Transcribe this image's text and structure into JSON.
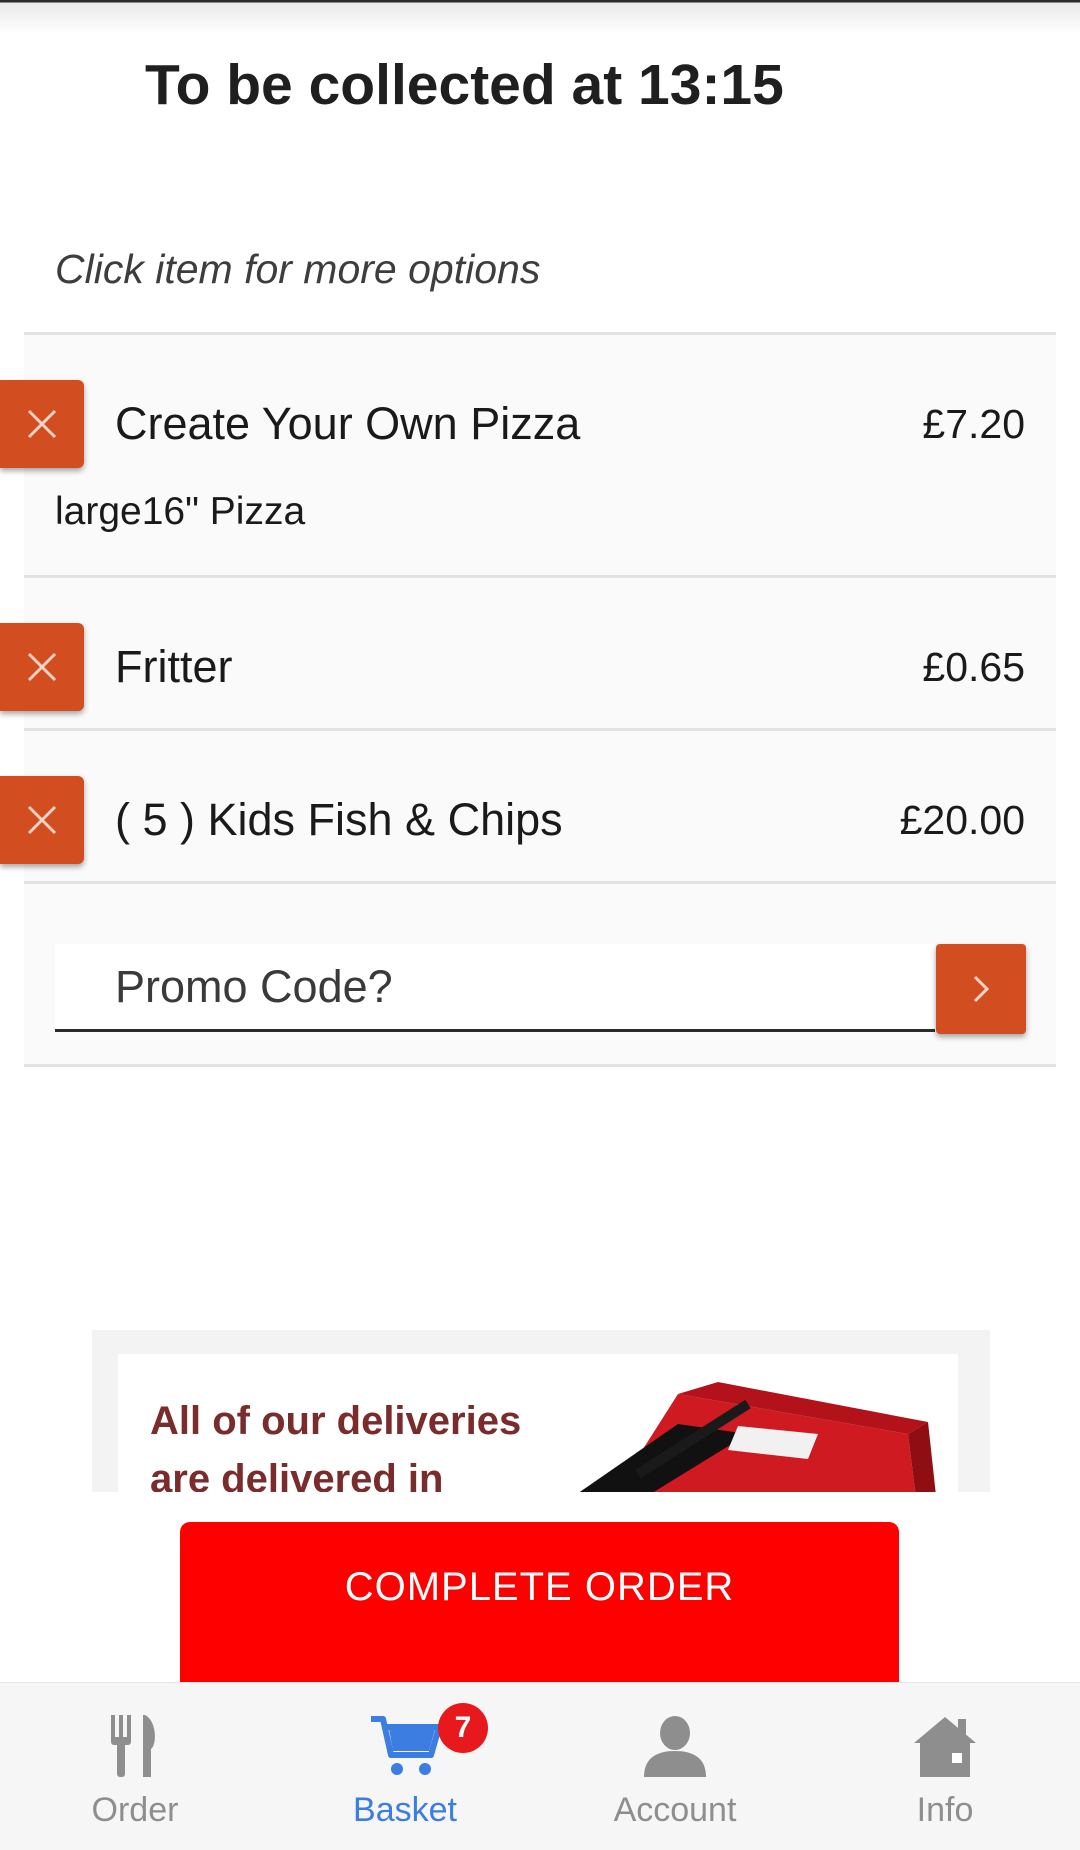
{
  "header": {
    "collection_title": "To be collected at 13:15",
    "hint": "Click item for more options"
  },
  "basket": {
    "items": [
      {
        "name": "Create Your Own Pizza",
        "price": "£7.20",
        "detail": "large16\" Pizza"
      },
      {
        "name": "Fritter",
        "price": "£0.65"
      },
      {
        "name": "( 5 ) Kids Fish & Chips",
        "price": "£20.00"
      }
    ]
  },
  "promo": {
    "placeholder": "Promo Code?"
  },
  "banner": {
    "line1": "All of our deliveries",
    "line2": "are delivered in"
  },
  "actions": {
    "complete_label": "COMPLETE ORDER"
  },
  "tabbar": {
    "tabs": [
      {
        "label": "Order",
        "icon": "fork-knife-icon"
      },
      {
        "label": "Basket",
        "icon": "cart-icon",
        "badge": "7",
        "active": true
      },
      {
        "label": "Account",
        "icon": "person-icon"
      },
      {
        "label": "Info",
        "icon": "house-icon"
      }
    ]
  },
  "colors": {
    "accent": "#d24d20",
    "primary_button": "#fe0000",
    "active_tab": "#3b7de0",
    "badge": "#e8191d"
  }
}
